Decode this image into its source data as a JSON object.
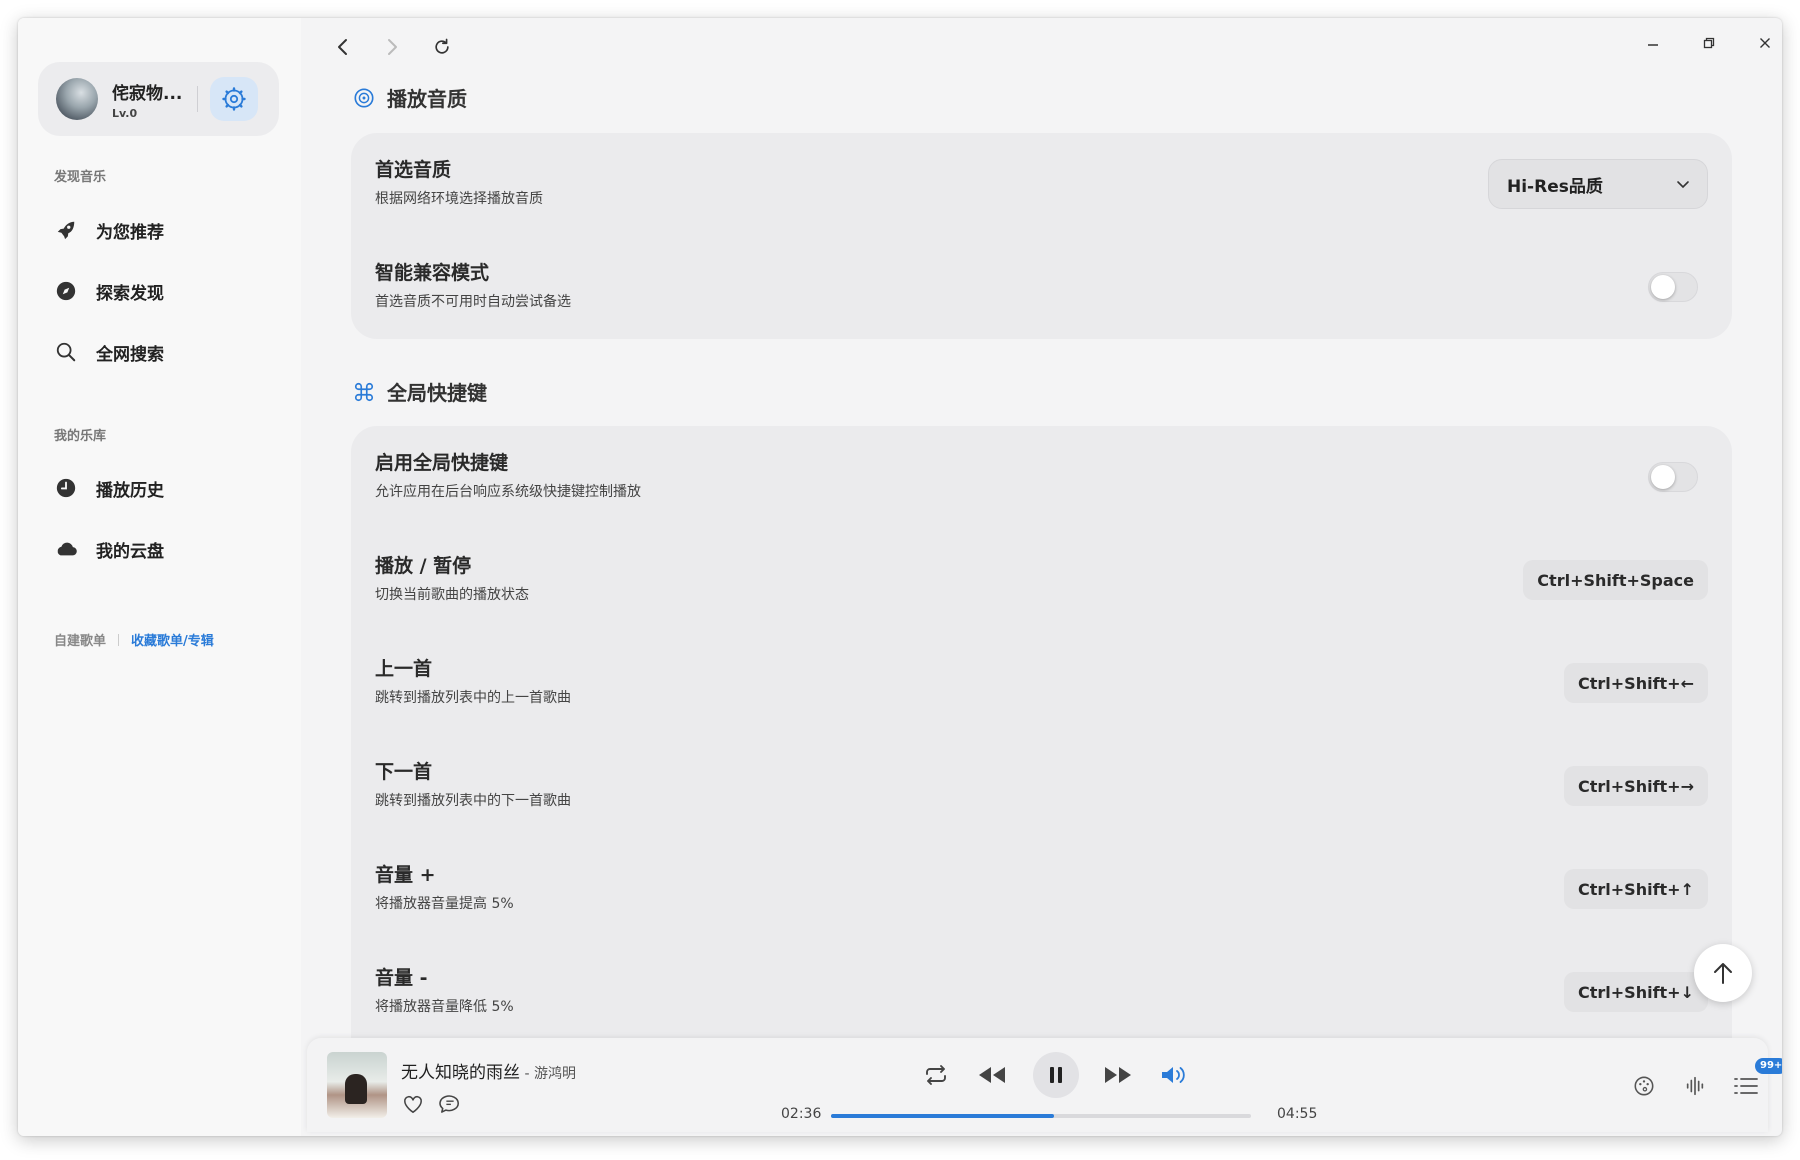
{
  "user": {
    "name": "侘寂物...",
    "level": "Lv.0"
  },
  "sidebar": {
    "discover_label": "发现音乐",
    "discover_items": [
      {
        "label": "为您推荐",
        "icon": "rocket-icon"
      },
      {
        "label": "探索发现",
        "icon": "compass-icon"
      },
      {
        "label": "全网搜索",
        "icon": "search-icon"
      }
    ],
    "library_label": "我的乐库",
    "library_items": [
      {
        "label": "播放历史",
        "icon": "clock-icon"
      },
      {
        "label": "我的云盘",
        "icon": "cloud-icon"
      }
    ],
    "playlist_tabs": {
      "own": "自建歌单",
      "favorite": "收藏歌单/专辑"
    }
  },
  "settings": {
    "quality_section": {
      "title": "播放音质",
      "preferred": {
        "title": "首选音质",
        "desc": "根据网络环境选择播放音质",
        "value": "Hi-Res品质"
      },
      "smart": {
        "title": "智能兼容模式",
        "desc": "首选音质不可用时自动尝试备选",
        "enabled": false
      }
    },
    "hotkey_section": {
      "title": "全局快捷键",
      "enable": {
        "title": "启用全局快捷键",
        "desc": "允许应用在后台响应系统级快捷键控制播放",
        "enabled": false
      },
      "items": [
        {
          "title": "播放 / 暂停",
          "desc": "切换当前歌曲的播放状态",
          "key": "Ctrl+Shift+Space"
        },
        {
          "title": "上一首",
          "desc": "跳转到播放列表中的上一首歌曲",
          "key": "Ctrl+Shift+←"
        },
        {
          "title": "下一首",
          "desc": "跳转到播放列表中的下一首歌曲",
          "key": "Ctrl+Shift+→"
        },
        {
          "title": "音量 +",
          "desc": "将播放器音量提高 5%",
          "key": "Ctrl+Shift+↑"
        },
        {
          "title": "音量 -",
          "desc": "将播放器音量降低 5%",
          "key": "Ctrl+Shift+↓"
        }
      ]
    }
  },
  "player": {
    "song": "无人知晓的雨丝",
    "artist": " - 游鸿明",
    "current_time": "02:36",
    "total_time": "04:55",
    "progress": 0.53,
    "queue_badge": "99+"
  },
  "colors": {
    "accent": "#2a7bd8"
  }
}
